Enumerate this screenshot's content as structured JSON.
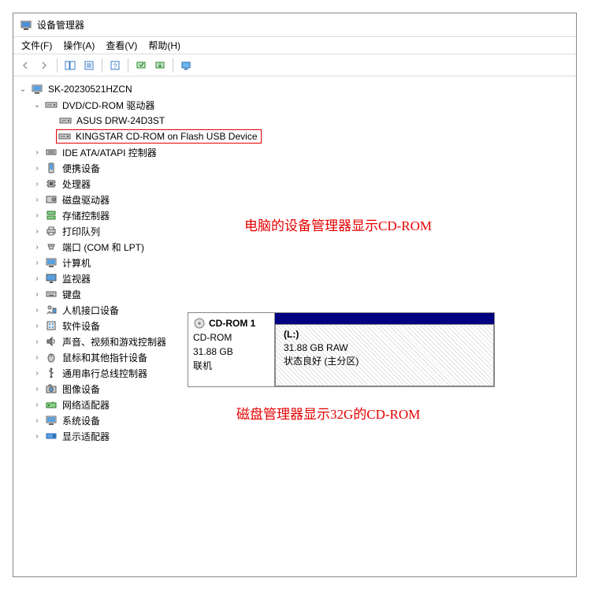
{
  "window": {
    "title": "设备管理器"
  },
  "menu": {
    "file": "文件(F)",
    "action": "操作(A)",
    "view": "查看(V)",
    "help": "帮助(H)"
  },
  "tree": {
    "root": "SK-20230521HZCN",
    "dvd": {
      "category": "DVD/CD-ROM 驱动器",
      "item1": "ASUS DRW-24D3ST",
      "item2": "KINGSTAR CD-ROM on Flash USB Device"
    },
    "ide": "IDE ATA/ATAPI 控制器",
    "portable": "便携设备",
    "cpu": "处理器",
    "disk": "磁盘驱动器",
    "storage": "存储控制器",
    "printq": "打印队列",
    "ports": "端口 (COM 和 LPT)",
    "computer": "计算机",
    "monitor": "监视器",
    "keyboard": "键盘",
    "hid": "人机接口设备",
    "software": "软件设备",
    "sound": "声音、视频和游戏控制器",
    "mouse": "鼠标和其他指针设备",
    "usb": "通用串行总线控制器",
    "imaging": "图像设备",
    "network": "网络适配器",
    "system": "系统设备",
    "display": "显示适配器"
  },
  "annotation1": "电脑的设备管理器显示CD-ROM",
  "annotation2": "磁盘管理器显示32G的CD-ROM",
  "diskmgr": {
    "title": "CD-ROM 1",
    "type": "CD-ROM",
    "size": "31.88 GB",
    "status": "联机",
    "part_letter": "(L:)",
    "part_size": "31.88 GB RAW",
    "part_status": "状态良好 (主分区)"
  }
}
